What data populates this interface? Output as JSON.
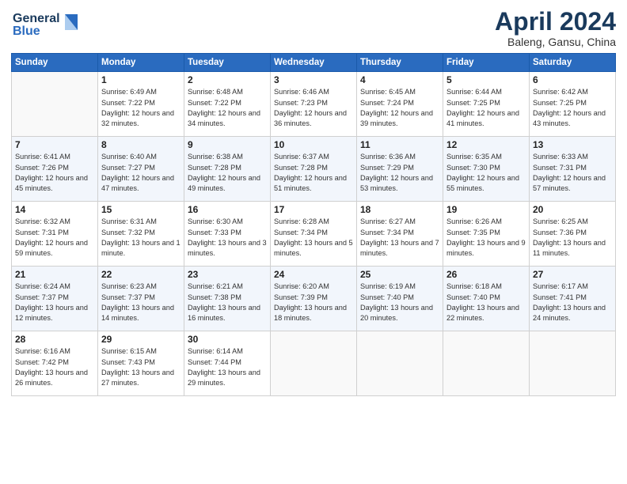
{
  "header": {
    "logo_line1": "General",
    "logo_line2": "Blue",
    "month_title": "April 2024",
    "location": "Baleng, Gansu, China"
  },
  "weekdays": [
    "Sunday",
    "Monday",
    "Tuesday",
    "Wednesday",
    "Thursday",
    "Friday",
    "Saturday"
  ],
  "weeks": [
    [
      {
        "day": "",
        "empty": true
      },
      {
        "day": "1",
        "sunrise": "Sunrise: 6:49 AM",
        "sunset": "Sunset: 7:22 PM",
        "daylight": "Daylight: 12 hours and 32 minutes."
      },
      {
        "day": "2",
        "sunrise": "Sunrise: 6:48 AM",
        "sunset": "Sunset: 7:22 PM",
        "daylight": "Daylight: 12 hours and 34 minutes."
      },
      {
        "day": "3",
        "sunrise": "Sunrise: 6:46 AM",
        "sunset": "Sunset: 7:23 PM",
        "daylight": "Daylight: 12 hours and 36 minutes."
      },
      {
        "day": "4",
        "sunrise": "Sunrise: 6:45 AM",
        "sunset": "Sunset: 7:24 PM",
        "daylight": "Daylight: 12 hours and 39 minutes."
      },
      {
        "day": "5",
        "sunrise": "Sunrise: 6:44 AM",
        "sunset": "Sunset: 7:25 PM",
        "daylight": "Daylight: 12 hours and 41 minutes."
      },
      {
        "day": "6",
        "sunrise": "Sunrise: 6:42 AM",
        "sunset": "Sunset: 7:25 PM",
        "daylight": "Daylight: 12 hours and 43 minutes."
      }
    ],
    [
      {
        "day": "7",
        "sunrise": "Sunrise: 6:41 AM",
        "sunset": "Sunset: 7:26 PM",
        "daylight": "Daylight: 12 hours and 45 minutes."
      },
      {
        "day": "8",
        "sunrise": "Sunrise: 6:40 AM",
        "sunset": "Sunset: 7:27 PM",
        "daylight": "Daylight: 12 hours and 47 minutes."
      },
      {
        "day": "9",
        "sunrise": "Sunrise: 6:38 AM",
        "sunset": "Sunset: 7:28 PM",
        "daylight": "Daylight: 12 hours and 49 minutes."
      },
      {
        "day": "10",
        "sunrise": "Sunrise: 6:37 AM",
        "sunset": "Sunset: 7:28 PM",
        "daylight": "Daylight: 12 hours and 51 minutes."
      },
      {
        "day": "11",
        "sunrise": "Sunrise: 6:36 AM",
        "sunset": "Sunset: 7:29 PM",
        "daylight": "Daylight: 12 hours and 53 minutes."
      },
      {
        "day": "12",
        "sunrise": "Sunrise: 6:35 AM",
        "sunset": "Sunset: 7:30 PM",
        "daylight": "Daylight: 12 hours and 55 minutes."
      },
      {
        "day": "13",
        "sunrise": "Sunrise: 6:33 AM",
        "sunset": "Sunset: 7:31 PM",
        "daylight": "Daylight: 12 hours and 57 minutes."
      }
    ],
    [
      {
        "day": "14",
        "sunrise": "Sunrise: 6:32 AM",
        "sunset": "Sunset: 7:31 PM",
        "daylight": "Daylight: 12 hours and 59 minutes."
      },
      {
        "day": "15",
        "sunrise": "Sunrise: 6:31 AM",
        "sunset": "Sunset: 7:32 PM",
        "daylight": "Daylight: 13 hours and 1 minute."
      },
      {
        "day": "16",
        "sunrise": "Sunrise: 6:30 AM",
        "sunset": "Sunset: 7:33 PM",
        "daylight": "Daylight: 13 hours and 3 minutes."
      },
      {
        "day": "17",
        "sunrise": "Sunrise: 6:28 AM",
        "sunset": "Sunset: 7:34 PM",
        "daylight": "Daylight: 13 hours and 5 minutes."
      },
      {
        "day": "18",
        "sunrise": "Sunrise: 6:27 AM",
        "sunset": "Sunset: 7:34 PM",
        "daylight": "Daylight: 13 hours and 7 minutes."
      },
      {
        "day": "19",
        "sunrise": "Sunrise: 6:26 AM",
        "sunset": "Sunset: 7:35 PM",
        "daylight": "Daylight: 13 hours and 9 minutes."
      },
      {
        "day": "20",
        "sunrise": "Sunrise: 6:25 AM",
        "sunset": "Sunset: 7:36 PM",
        "daylight": "Daylight: 13 hours and 11 minutes."
      }
    ],
    [
      {
        "day": "21",
        "sunrise": "Sunrise: 6:24 AM",
        "sunset": "Sunset: 7:37 PM",
        "daylight": "Daylight: 13 hours and 12 minutes."
      },
      {
        "day": "22",
        "sunrise": "Sunrise: 6:23 AM",
        "sunset": "Sunset: 7:37 PM",
        "daylight": "Daylight: 13 hours and 14 minutes."
      },
      {
        "day": "23",
        "sunrise": "Sunrise: 6:21 AM",
        "sunset": "Sunset: 7:38 PM",
        "daylight": "Daylight: 13 hours and 16 minutes."
      },
      {
        "day": "24",
        "sunrise": "Sunrise: 6:20 AM",
        "sunset": "Sunset: 7:39 PM",
        "daylight": "Daylight: 13 hours and 18 minutes."
      },
      {
        "day": "25",
        "sunrise": "Sunrise: 6:19 AM",
        "sunset": "Sunset: 7:40 PM",
        "daylight": "Daylight: 13 hours and 20 minutes."
      },
      {
        "day": "26",
        "sunrise": "Sunrise: 6:18 AM",
        "sunset": "Sunset: 7:40 PM",
        "daylight": "Daylight: 13 hours and 22 minutes."
      },
      {
        "day": "27",
        "sunrise": "Sunrise: 6:17 AM",
        "sunset": "Sunset: 7:41 PM",
        "daylight": "Daylight: 13 hours and 24 minutes."
      }
    ],
    [
      {
        "day": "28",
        "sunrise": "Sunrise: 6:16 AM",
        "sunset": "Sunset: 7:42 PM",
        "daylight": "Daylight: 13 hours and 26 minutes."
      },
      {
        "day": "29",
        "sunrise": "Sunrise: 6:15 AM",
        "sunset": "Sunset: 7:43 PM",
        "daylight": "Daylight: 13 hours and 27 minutes."
      },
      {
        "day": "30",
        "sunrise": "Sunrise: 6:14 AM",
        "sunset": "Sunset: 7:44 PM",
        "daylight": "Daylight: 13 hours and 29 minutes."
      },
      {
        "day": "",
        "empty": true
      },
      {
        "day": "",
        "empty": true
      },
      {
        "day": "",
        "empty": true
      },
      {
        "day": "",
        "empty": true
      }
    ]
  ]
}
